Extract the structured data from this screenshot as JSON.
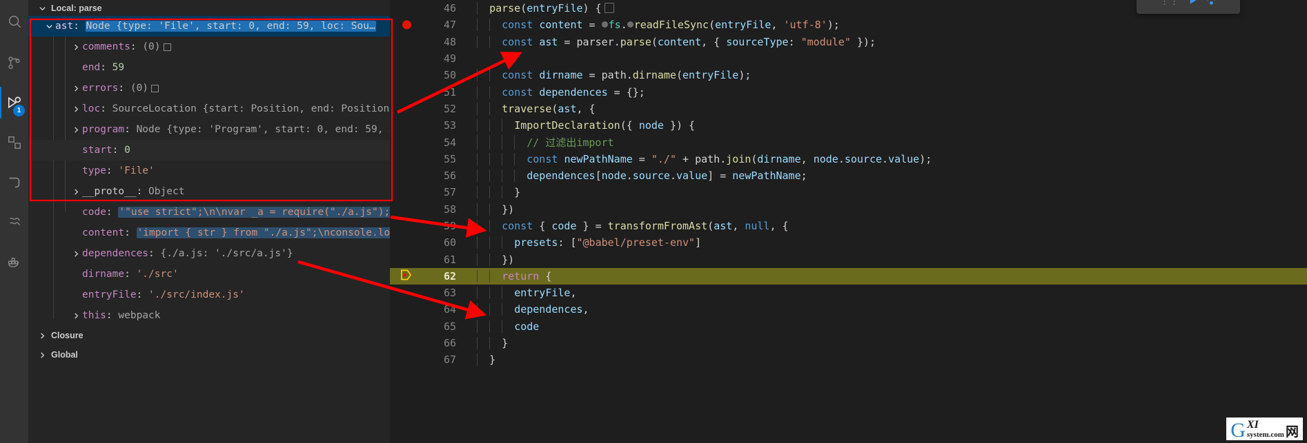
{
  "activity_bar": {
    "items": [
      {
        "name": "search-icon",
        "label": "Search"
      },
      {
        "name": "source-control-icon",
        "label": "Source Control"
      },
      {
        "name": "run-and-debug-icon",
        "label": "Run and Debug",
        "badge": "1",
        "active": true
      },
      {
        "name": "extensions-icon",
        "label": "Extensions"
      },
      {
        "name": "remote-explorer-icon",
        "label": "Remote Explorer"
      },
      {
        "name": "testing-icon",
        "label": "Testing"
      },
      {
        "name": "docker-icon",
        "label": "Docker"
      }
    ]
  },
  "sidebar": {
    "scopes": [
      {
        "label": "Local: parse",
        "expanded": true
      },
      {
        "label": "Closure",
        "expanded": false
      },
      {
        "label": "Global",
        "expanded": false
      }
    ],
    "variables": [
      {
        "key": "ast",
        "sep": ": ",
        "value": "Node {type: 'File', start: 0, end: 59, loc: Sou…",
        "kind": "obj",
        "expandable": true,
        "expanded": true,
        "selected": true,
        "highlight": true,
        "depth": 1
      },
      {
        "key": "comments",
        "sep": ": ",
        "value": "(0)",
        "kind": "dim",
        "expandable": true,
        "expanded": false,
        "depth": 2,
        "box": true
      },
      {
        "key": "end",
        "sep": ": ",
        "value": "59",
        "kind": "num",
        "expandable": false,
        "depth": 2
      },
      {
        "key": "errors",
        "sep": ": ",
        "value": "(0)",
        "kind": "dim",
        "expandable": true,
        "expanded": false,
        "depth": 2,
        "box": true
      },
      {
        "key": "loc",
        "sep": ": ",
        "value": "SourceLocation {start: Position, end: Position…",
        "kind": "obj",
        "expandable": true,
        "expanded": false,
        "depth": 2
      },
      {
        "key": "program",
        "sep": ": ",
        "value": "Node {type: 'Program', start: 0, end: 59, …",
        "kind": "obj",
        "expandable": true,
        "expanded": false,
        "depth": 2
      },
      {
        "key": "start",
        "sep": ": ",
        "value": "0",
        "kind": "num",
        "expandable": false,
        "depth": 2,
        "shaded": true
      },
      {
        "key": "type",
        "sep": ": ",
        "value": "'File'",
        "kind": "str",
        "expandable": false,
        "depth": 2
      },
      {
        "key": "__proto__",
        "sep": ": ",
        "value": "Object",
        "kind": "dim",
        "expandable": true,
        "expanded": false,
        "depth": 2,
        "plainkey": true
      },
      {
        "key": "code",
        "sep": ": ",
        "value": "'\"use strict\";\\n\\nvar _a = require(\"./a.js\");\\…",
        "kind": "str",
        "expandable": false,
        "depth": 1,
        "highlight": true
      },
      {
        "key": "content",
        "sep": ": ",
        "value": "'import { str } from \"./a.js\";\\nconsole.log…",
        "kind": "str",
        "expandable": false,
        "depth": 1,
        "highlight": true
      },
      {
        "key": "dependences",
        "sep": ": ",
        "value": "{./a.js: './src/a.js'}",
        "kind": "obj",
        "expandable": true,
        "expanded": false,
        "depth": 1
      },
      {
        "key": "dirname",
        "sep": ": ",
        "value": "'./src'",
        "kind": "str",
        "expandable": false,
        "depth": 1
      },
      {
        "key": "entryFile",
        "sep": ": ",
        "value": "'./src/index.js'",
        "kind": "str",
        "expandable": false,
        "depth": 1
      },
      {
        "key": "this",
        "sep": ": ",
        "value": "webpack",
        "kind": "dim",
        "expandable": true,
        "expanded": false,
        "depth": 1
      }
    ]
  },
  "editor": {
    "current_line": 62,
    "breakpoint_line": 47,
    "lines": [
      {
        "num": "46",
        "tokens": [
          {
            "t": "  ",
            "c": "pn"
          },
          {
            "t": "parse",
            "c": "fn"
          },
          {
            "t": "(",
            "c": "pn"
          },
          {
            "t": "entryFile",
            "c": "var"
          },
          {
            "t": ") {",
            "c": "pn"
          }
        ]
      },
      {
        "num": "47",
        "breakpoint": true,
        "tokens": [
          {
            "t": "    ",
            "c": "pn"
          },
          {
            "t": "const",
            "c": "kw"
          },
          {
            "t": " ",
            "c": "pn"
          },
          {
            "t": "content",
            "c": "var"
          },
          {
            "t": " = ",
            "c": "pn"
          },
          {
            "t": "fs",
            "c": "cls"
          },
          {
            "t": ".",
            "c": "pn"
          },
          {
            "t": "readFileSync",
            "c": "fn"
          },
          {
            "t": "(",
            "c": "pn"
          },
          {
            "t": "entryFile",
            "c": "var"
          },
          {
            "t": ", ",
            "c": "pn"
          },
          {
            "t": "'utf-8'",
            "c": "str"
          },
          {
            "t": ");",
            "c": "pn"
          }
        ]
      },
      {
        "num": "48",
        "tokens": [
          {
            "t": "    ",
            "c": "pn"
          },
          {
            "t": "const",
            "c": "kw"
          },
          {
            "t": " ",
            "c": "pn"
          },
          {
            "t": "ast",
            "c": "var"
          },
          {
            "t": " = ",
            "c": "pn"
          },
          {
            "t": "parser",
            "c": "pn"
          },
          {
            "t": ".",
            "c": "pn"
          },
          {
            "t": "parse",
            "c": "fn"
          },
          {
            "t": "(",
            "c": "pn"
          },
          {
            "t": "content",
            "c": "var"
          },
          {
            "t": ", { ",
            "c": "pn"
          },
          {
            "t": "sourceType",
            "c": "var"
          },
          {
            "t": ": ",
            "c": "pn"
          },
          {
            "t": "\"module\"",
            "c": "str"
          },
          {
            "t": " });",
            "c": "pn"
          }
        ]
      },
      {
        "num": "49",
        "tokens": []
      },
      {
        "num": "50",
        "tokens": [
          {
            "t": "    ",
            "c": "pn"
          },
          {
            "t": "const",
            "c": "kw"
          },
          {
            "t": " ",
            "c": "pn"
          },
          {
            "t": "dirname",
            "c": "var"
          },
          {
            "t": " = ",
            "c": "pn"
          },
          {
            "t": "path",
            "c": "pn"
          },
          {
            "t": ".",
            "c": "pn"
          },
          {
            "t": "dirname",
            "c": "fn"
          },
          {
            "t": "(",
            "c": "pn"
          },
          {
            "t": "entryFile",
            "c": "var"
          },
          {
            "t": ");",
            "c": "pn"
          }
        ]
      },
      {
        "num": "51",
        "tokens": [
          {
            "t": "    ",
            "c": "pn"
          },
          {
            "t": "const",
            "c": "kw"
          },
          {
            "t": " ",
            "c": "pn"
          },
          {
            "t": "dependences",
            "c": "var"
          },
          {
            "t": " = {};",
            "c": "pn"
          }
        ]
      },
      {
        "num": "52",
        "tokens": [
          {
            "t": "    ",
            "c": "pn"
          },
          {
            "t": "traverse",
            "c": "fn"
          },
          {
            "t": "(",
            "c": "pn"
          },
          {
            "t": "ast",
            "c": "var"
          },
          {
            "t": ", {",
            "c": "pn"
          }
        ]
      },
      {
        "num": "53",
        "tokens": [
          {
            "t": "      ",
            "c": "pn"
          },
          {
            "t": "ImportDeclaration",
            "c": "fn"
          },
          {
            "t": "({ ",
            "c": "pn"
          },
          {
            "t": "node",
            "c": "var"
          },
          {
            "t": " }) {",
            "c": "pn"
          }
        ]
      },
      {
        "num": "54",
        "tokens": [
          {
            "t": "        ",
            "c": "pn"
          },
          {
            "t": "// 过滤出import",
            "c": "cmt"
          }
        ]
      },
      {
        "num": "55",
        "tokens": [
          {
            "t": "        ",
            "c": "pn"
          },
          {
            "t": "const",
            "c": "kw"
          },
          {
            "t": " ",
            "c": "pn"
          },
          {
            "t": "newPathName",
            "c": "var"
          },
          {
            "t": " = ",
            "c": "pn"
          },
          {
            "t": "\"./\"",
            "c": "str"
          },
          {
            "t": " + ",
            "c": "pn"
          },
          {
            "t": "path",
            "c": "pn"
          },
          {
            "t": ".",
            "c": "pn"
          },
          {
            "t": "join",
            "c": "fn"
          },
          {
            "t": "(",
            "c": "pn"
          },
          {
            "t": "dirname",
            "c": "var"
          },
          {
            "t": ", ",
            "c": "pn"
          },
          {
            "t": "node",
            "c": "var"
          },
          {
            "t": ".",
            "c": "pn"
          },
          {
            "t": "source",
            "c": "var"
          },
          {
            "t": ".",
            "c": "pn"
          },
          {
            "t": "value",
            "c": "var"
          },
          {
            "t": ");",
            "c": "pn"
          }
        ]
      },
      {
        "num": "56",
        "tokens": [
          {
            "t": "        ",
            "c": "pn"
          },
          {
            "t": "dependences",
            "c": "var"
          },
          {
            "t": "[",
            "c": "pn"
          },
          {
            "t": "node",
            "c": "var"
          },
          {
            "t": ".",
            "c": "pn"
          },
          {
            "t": "source",
            "c": "var"
          },
          {
            "t": ".",
            "c": "pn"
          },
          {
            "t": "value",
            "c": "var"
          },
          {
            "t": "] = ",
            "c": "pn"
          },
          {
            "t": "newPathName",
            "c": "var"
          },
          {
            "t": ";",
            "c": "pn"
          }
        ]
      },
      {
        "num": "57",
        "tokens": [
          {
            "t": "      }",
            "c": "pn"
          }
        ]
      },
      {
        "num": "58",
        "tokens": [
          {
            "t": "    })",
            "c": "pn"
          }
        ]
      },
      {
        "num": "59",
        "tokens": [
          {
            "t": "    ",
            "c": "pn"
          },
          {
            "t": "const",
            "c": "kw"
          },
          {
            "t": " { ",
            "c": "pn"
          },
          {
            "t": "code",
            "c": "var"
          },
          {
            "t": " } = ",
            "c": "pn"
          },
          {
            "t": "transformFromAst",
            "c": "fn"
          },
          {
            "t": "(",
            "c": "pn"
          },
          {
            "t": "ast",
            "c": "var"
          },
          {
            "t": ", ",
            "c": "pn"
          },
          {
            "t": "null",
            "c": "kw"
          },
          {
            "t": ", {",
            "c": "pn"
          }
        ]
      },
      {
        "num": "60",
        "tokens": [
          {
            "t": "      ",
            "c": "pn"
          },
          {
            "t": "presets",
            "c": "var"
          },
          {
            "t": ": [",
            "c": "pn"
          },
          {
            "t": "\"@babel/preset-env\"",
            "c": "str"
          },
          {
            "t": "]",
            "c": "pn"
          }
        ]
      },
      {
        "num": "61",
        "tokens": [
          {
            "t": "    })",
            "c": "pn"
          }
        ]
      },
      {
        "num": "62",
        "current": true,
        "tokens": [
          {
            "t": "    ",
            "c": "pn"
          },
          {
            "t": "return",
            "c": "ctl"
          },
          {
            "t": " {",
            "c": "pn"
          }
        ]
      },
      {
        "num": "63",
        "tokens": [
          {
            "t": "      ",
            "c": "pn"
          },
          {
            "t": "entryFile",
            "c": "var"
          },
          {
            "t": ",",
            "c": "pn"
          }
        ]
      },
      {
        "num": "64",
        "tokens": [
          {
            "t": "      ",
            "c": "pn"
          },
          {
            "t": "dependences",
            "c": "var"
          },
          {
            "t": ",",
            "c": "pn"
          }
        ]
      },
      {
        "num": "65",
        "tokens": [
          {
            "t": "      ",
            "c": "pn"
          },
          {
            "t": "code",
            "c": "var"
          }
        ]
      },
      {
        "num": "66",
        "tokens": [
          {
            "t": "    }",
            "c": "pn"
          }
        ]
      },
      {
        "num": "67",
        "tokens": [
          {
            "t": "  }",
            "c": "pn"
          }
        ]
      }
    ]
  },
  "debug_toolbar": {
    "grip": "⋮⋮",
    "buttons": [
      "continue",
      "step-over"
    ]
  },
  "annotations": {
    "boxes": [
      {
        "name": "ast-node-highlight-box",
        "color": "#ff0000"
      }
    ],
    "arrows": [
      {
        "name": "arrow-ast-to-line48",
        "color": "#ff0000"
      },
      {
        "name": "arrow-code-to-line59",
        "color": "#ff0000"
      },
      {
        "name": "arrow-dependences-to-line64",
        "color": "#ff0000"
      }
    ]
  },
  "watermark": {
    "g": "G",
    "xi": "XI",
    "cn": "网",
    "site": "system.com"
  },
  "colors": {
    "editor_bg": "#1e1e1e",
    "sidebar_bg": "#252526",
    "activity_bg": "#333333",
    "selection_blue": "#04395e",
    "accent_blue": "#0078d4",
    "current_line": "#6b6b1e",
    "breakpoint_red": "#e51400",
    "annotation_red": "#ff0000"
  }
}
